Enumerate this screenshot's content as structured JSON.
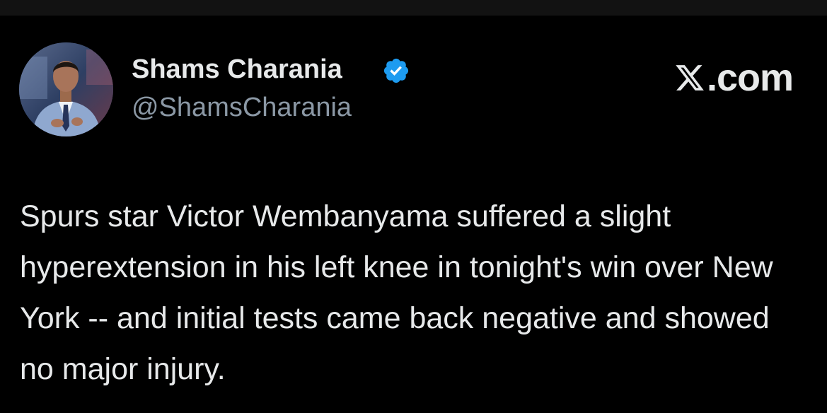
{
  "author": {
    "display_name": "Shams Charania",
    "handle": "@ShamsCharania",
    "verified": true
  },
  "brand": {
    "suffix": ".com"
  },
  "tweet": {
    "text": "Spurs star Victor Wembanyama suffered a slight hyperextension in his left knee in tonight's win over New York -- and initial tests came back negative and showed no major injury."
  },
  "icons": {
    "verified": "verified-badge-icon",
    "brand": "x-logo-icon"
  },
  "colors": {
    "background": "#000000",
    "text_primary": "#e7e9ea",
    "text_secondary": "#8b98a5",
    "verified_blue": "#1d9bf0"
  }
}
